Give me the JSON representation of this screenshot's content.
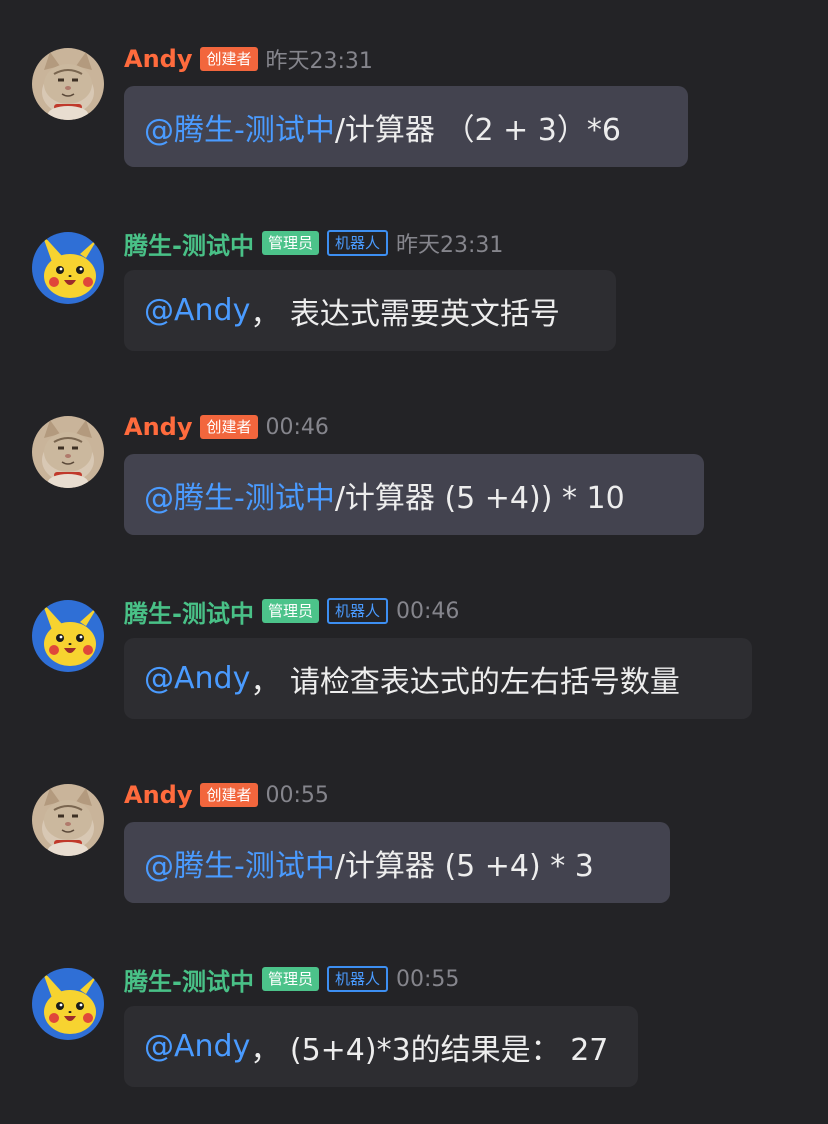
{
  "messages": [
    {
      "sender": "Andy",
      "role_badge": "创建者",
      "time": "昨天23:31",
      "mention": "@腾生-测试中",
      "text": " /计算器 （2 + 3）*6"
    },
    {
      "sender": "腾生-测试中",
      "role_badge": "管理员",
      "bot_badge": "机器人",
      "time": "昨天23:31",
      "mention": "@Andy",
      "text": "， 表达式需要英文括号"
    },
    {
      "sender": "Andy",
      "role_badge": "创建者",
      "time": "00:46",
      "mention": "@腾生-测试中",
      "text": " /计算器 (5  +4)) *  10"
    },
    {
      "sender": "腾生-测试中",
      "role_badge": "管理员",
      "bot_badge": "机器人",
      "time": "00:46",
      "mention": "@Andy",
      "text": "， 请检查表达式的左右括号数量"
    },
    {
      "sender": "Andy",
      "role_badge": "创建者",
      "time": "00:55",
      "mention": "@腾生-测试中",
      "text": " /计算器 (5 +4)  *  3"
    },
    {
      "sender": "腾生-测试中",
      "role_badge": "管理员",
      "bot_badge": "机器人",
      "time": "00:55",
      "mention": "@Andy",
      "text": "， (5+4)*3的结果是： 27"
    }
  ],
  "colors": {
    "background": "#232326",
    "user_name": "#ff6b3d",
    "bot_name": "#49c187",
    "mention": "#4a9bff",
    "creator_badge": "#f2663d",
    "admin_badge": "#4cc38a",
    "robot_badge_border": "#3d8ff2"
  },
  "avatars": {
    "user": "cat-avatar-icon",
    "bot": "pikachu-avatar-icon"
  }
}
